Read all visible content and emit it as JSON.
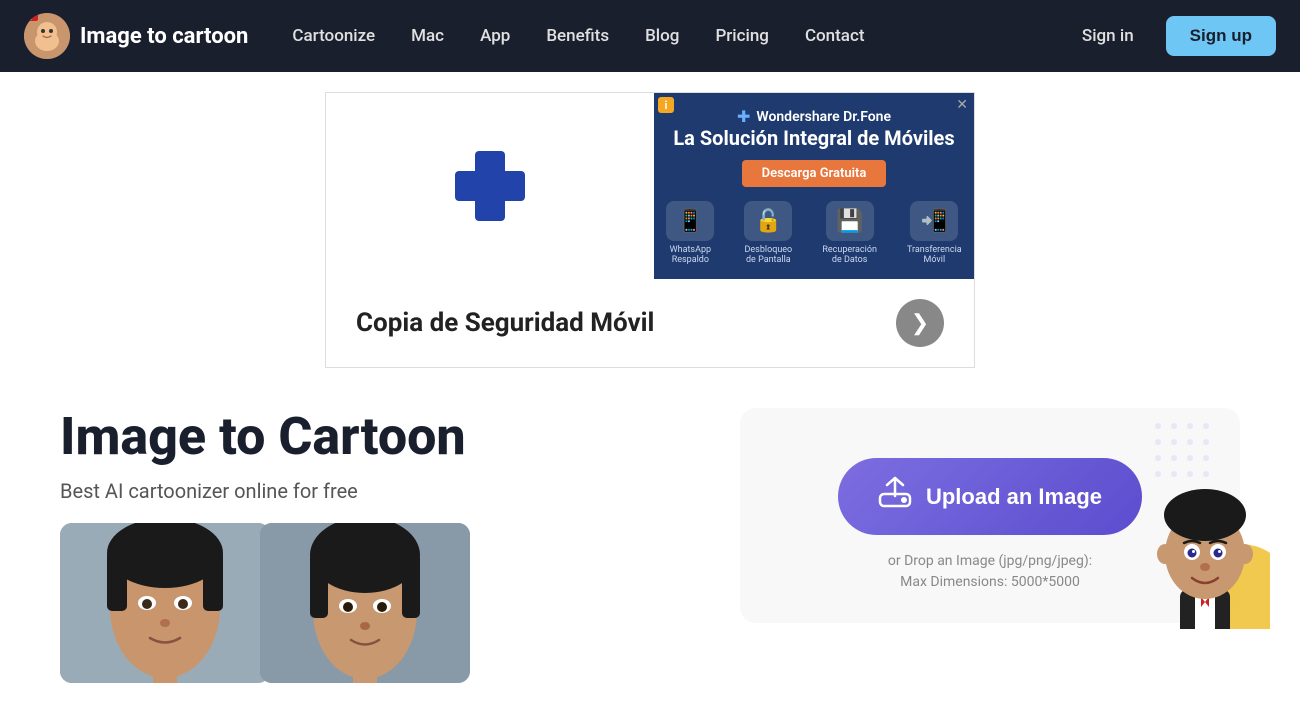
{
  "navbar": {
    "logo_text": "Image to cartoon",
    "ai_badge": "AI",
    "nav_items": [
      {
        "label": "Cartoonize",
        "id": "cartoonize"
      },
      {
        "label": "Mac",
        "id": "mac"
      },
      {
        "label": "App",
        "id": "app"
      },
      {
        "label": "Benefits",
        "id": "benefits"
      },
      {
        "label": "Blog",
        "id": "blog"
      },
      {
        "label": "Pricing",
        "id": "pricing"
      },
      {
        "label": "Contact",
        "id": "contact"
      }
    ],
    "signin_label": "Sign in",
    "signup_label": "Sign up"
  },
  "ad": {
    "brand_name": "Wondershare Dr.Fone",
    "title": "La Solución Integral de Móviles",
    "cta_label": "Descarga Gratuita",
    "close_label": "✕",
    "info_label": "ⓘ",
    "icons": [
      {
        "label": "WhatsApp Respaldo"
      },
      {
        "label": "Desbloqueo de Pantalla"
      },
      {
        "label": "Recuperación de Datos"
      },
      {
        "label": "Transferencia Móvil"
      }
    ],
    "bottom_text": "Copia de Seguridad Móvil",
    "arrow": "❯"
  },
  "hero": {
    "title": "Image to Cartoon",
    "subtitle": "Best AI cartoonizer online for free",
    "upload_btn_label": "Upload an Image",
    "upload_hint_line1": "or Drop an Image (jpg/png/jpeg):",
    "upload_hint_line2": "Max Dimensions: 5000*5000"
  }
}
